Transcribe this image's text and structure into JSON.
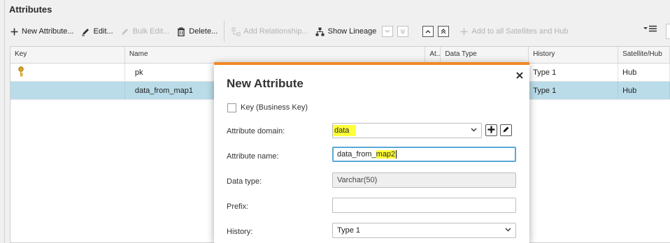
{
  "panel": {
    "title": "Attributes"
  },
  "toolbar": {
    "new_attribute": "New Attribute...",
    "edit": "Edit...",
    "bulk_edit": "Bulk Edit...",
    "delete": "Delete...",
    "add_relationship": "Add Relationship...",
    "show_lineage": "Show Lineage",
    "add_to_all_satellites": "Add to all Satellites and Hub"
  },
  "grid": {
    "columns": [
      "Key",
      "Name",
      "At...",
      "Data Type",
      "History",
      "Satellite/Hub"
    ],
    "rows": [
      {
        "key_icon": "key-icon",
        "name": "pk",
        "history": "Type 1",
        "satellite_hub": "Hub",
        "selected": false
      },
      {
        "key_icon": "",
        "name": "data_from_map1",
        "history": "Type 1",
        "satellite_hub": "Hub",
        "selected": true
      }
    ]
  },
  "dialog": {
    "title": "New Attribute",
    "key_checkbox_label": "Key (Business Key)",
    "key_checked": false,
    "domain_label": "Attribute domain:",
    "domain_value": "data",
    "name_label": "Attribute name:",
    "name_value_prefix": "data_from_",
    "name_value_highlight": "map2",
    "datatype_label": "Data type:",
    "datatype_value": "Varchar(50)",
    "prefix_label": "Prefix:",
    "prefix_value": "",
    "history_label": "History:",
    "history_value": "Type 1"
  },
  "colors": {
    "accent": "#f08a24",
    "selection": "#b9dce8",
    "focus": "#5aa9d6",
    "highlight": "#ffff3a"
  }
}
